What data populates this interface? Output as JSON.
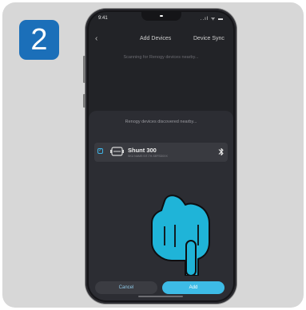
{
  "step": {
    "number": "2"
  },
  "status_bar": {
    "time": "9:41",
    "icons": "..ıl ᯤ ▬"
  },
  "nav": {
    "back_icon": "chevron-left-icon",
    "title": "Add Devices",
    "action": "Device Sync"
  },
  "scanning_text": "Scanning for Renogy devices nearby...",
  "sheet": {
    "title": "Renogy devices discovered nearby...",
    "device": {
      "selected": true,
      "icon": "shunt-icon",
      "name": "Shunt 300",
      "sub": "SKU NAME:SIT-TH-SEFSD0XX",
      "bluetooth_icon": "bluetooth-icon"
    },
    "cancel_label": "Cancel",
    "add_label": "Add"
  },
  "colors": {
    "card_bg": "#d7d7d7",
    "step_badge": "#1b6fb9",
    "accent": "#3dbbe6",
    "hand": "#1fb4d8",
    "screen_bg": "#222327",
    "sheet_bg": "#2c2d33"
  }
}
